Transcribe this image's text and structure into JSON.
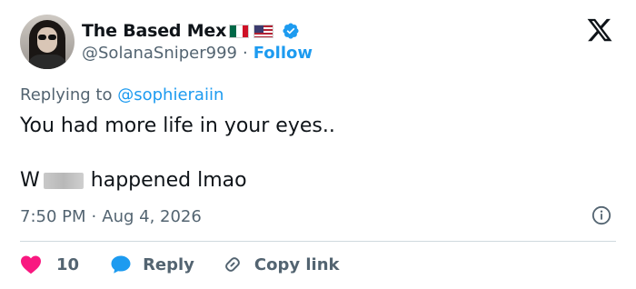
{
  "author": {
    "name": "The Based Mex",
    "handle": "@SolanaSniper999",
    "separator": "·",
    "follow_label": "Follow"
  },
  "reply_context": {
    "prefix": "Replying to",
    "mention": "@sophieraiin"
  },
  "tweet": {
    "line1": "You had more life in your eyes..",
    "line2_start": "W",
    "line2_end": "happened lmao"
  },
  "meta": {
    "time": "7:50 PM",
    "separator": "·",
    "date": "Aug 4, 2026"
  },
  "actions": {
    "like_count": "10",
    "reply_label": "Reply",
    "copy_link_label": "Copy link"
  },
  "colors": {
    "accent": "#1d9bf0",
    "like": "#f91880",
    "muted": "#536471"
  },
  "icons": [
    "avatar",
    "mexico-flag-icon",
    "usa-flag-icon",
    "verified-badge-icon",
    "x-logo-icon",
    "info-icon",
    "heart-icon",
    "reply-bubble-icon",
    "link-icon"
  ]
}
